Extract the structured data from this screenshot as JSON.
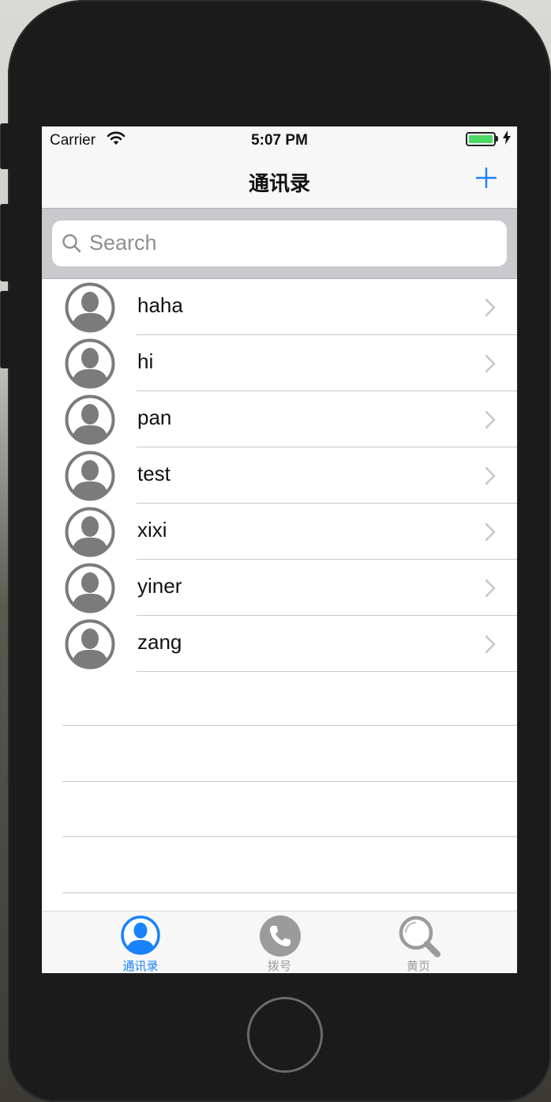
{
  "status_bar": {
    "carrier": "Carrier",
    "time": "5:07 PM"
  },
  "nav": {
    "title": "通讯录"
  },
  "search": {
    "placeholder": "Search"
  },
  "contacts": [
    {
      "name": "haha"
    },
    {
      "name": "hi"
    },
    {
      "name": "pan"
    },
    {
      "name": "test"
    },
    {
      "name": "xixi"
    },
    {
      "name": "yiner"
    },
    {
      "name": "zang"
    }
  ],
  "tabs": [
    {
      "label": "通讯录",
      "icon": "person-circle-icon",
      "selected": true
    },
    {
      "label": "拨号",
      "icon": "phone-icon",
      "selected": false
    },
    {
      "label": "黄页",
      "icon": "magnifier-icon",
      "selected": false
    }
  ],
  "colors": {
    "accent": "#1a82fb",
    "tab_inactive": "#9b9b9b",
    "battery": "#4cd964",
    "avatar": "#7b7b7b"
  }
}
